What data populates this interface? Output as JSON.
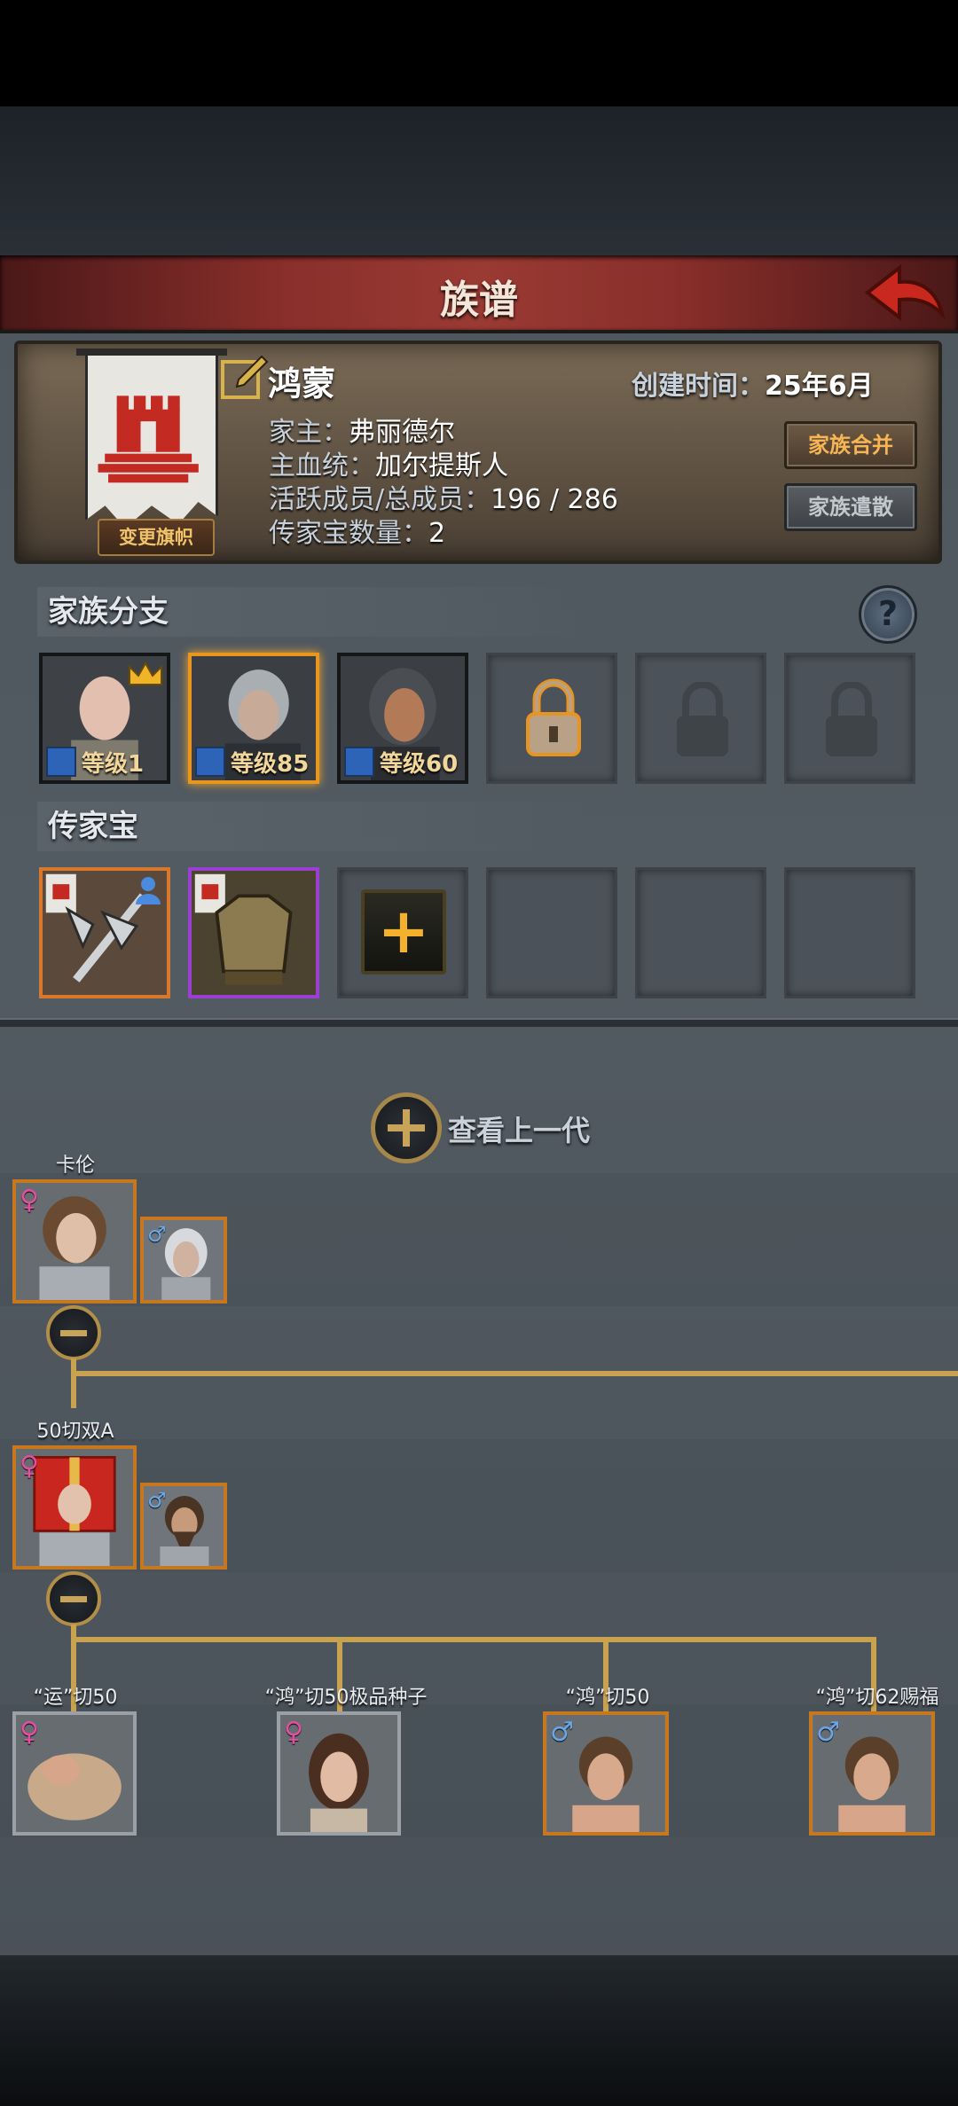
{
  "header": {
    "title": "族谱"
  },
  "family": {
    "name": "鸿蒙",
    "create_label": "创建时间：",
    "create_value": "25年6月",
    "head_label": "家主：",
    "head_value": "弗丽德尔",
    "bloodline_label": "主血统：",
    "bloodline_value": "加尔提斯人",
    "members_label": "活跃成员/总成员：",
    "members_value": "196 / 286",
    "heirloom_label": "传家宝数量：",
    "heirloom_value": "2",
    "change_banner": "变更旗帜",
    "merge_button": "家族合并",
    "disband_button": "家族遣散"
  },
  "branches": {
    "title": "家族分支",
    "help": "?",
    "members": [
      {
        "level": "等级1",
        "crown": true
      },
      {
        "level": "等级85",
        "selected": true
      },
      {
        "level": "等级60"
      }
    ],
    "locked_slots": 3
  },
  "heirlooms": {
    "title": "传家宝",
    "items": [
      {
        "name": "halberd",
        "rarity": "orange"
      },
      {
        "name": "armor",
        "rarity": "purple"
      }
    ],
    "add": "+",
    "empty_slots": 4
  },
  "tree": {
    "view_previous": "查看上一代",
    "gen1": {
      "name": "卡伦",
      "gender": "♀",
      "spouse_gender": "♂"
    },
    "gen2": {
      "name": "50切双A",
      "gender": "♀",
      "spouse_gender": "♂"
    },
    "children": [
      {
        "name": "“运”切50",
        "gender": "♀"
      },
      {
        "name": "“鸿”切50极品种子",
        "gender": "♀"
      },
      {
        "name": "“鸿”切50",
        "gender": "♂"
      },
      {
        "name": "“鸿”切62赐福",
        "gender": "♂"
      }
    ]
  },
  "colors": {
    "accent_gold": "#c9a250",
    "title_red": "#8a2f2b",
    "female": "#e24fa0",
    "male": "#6ba7e8"
  }
}
